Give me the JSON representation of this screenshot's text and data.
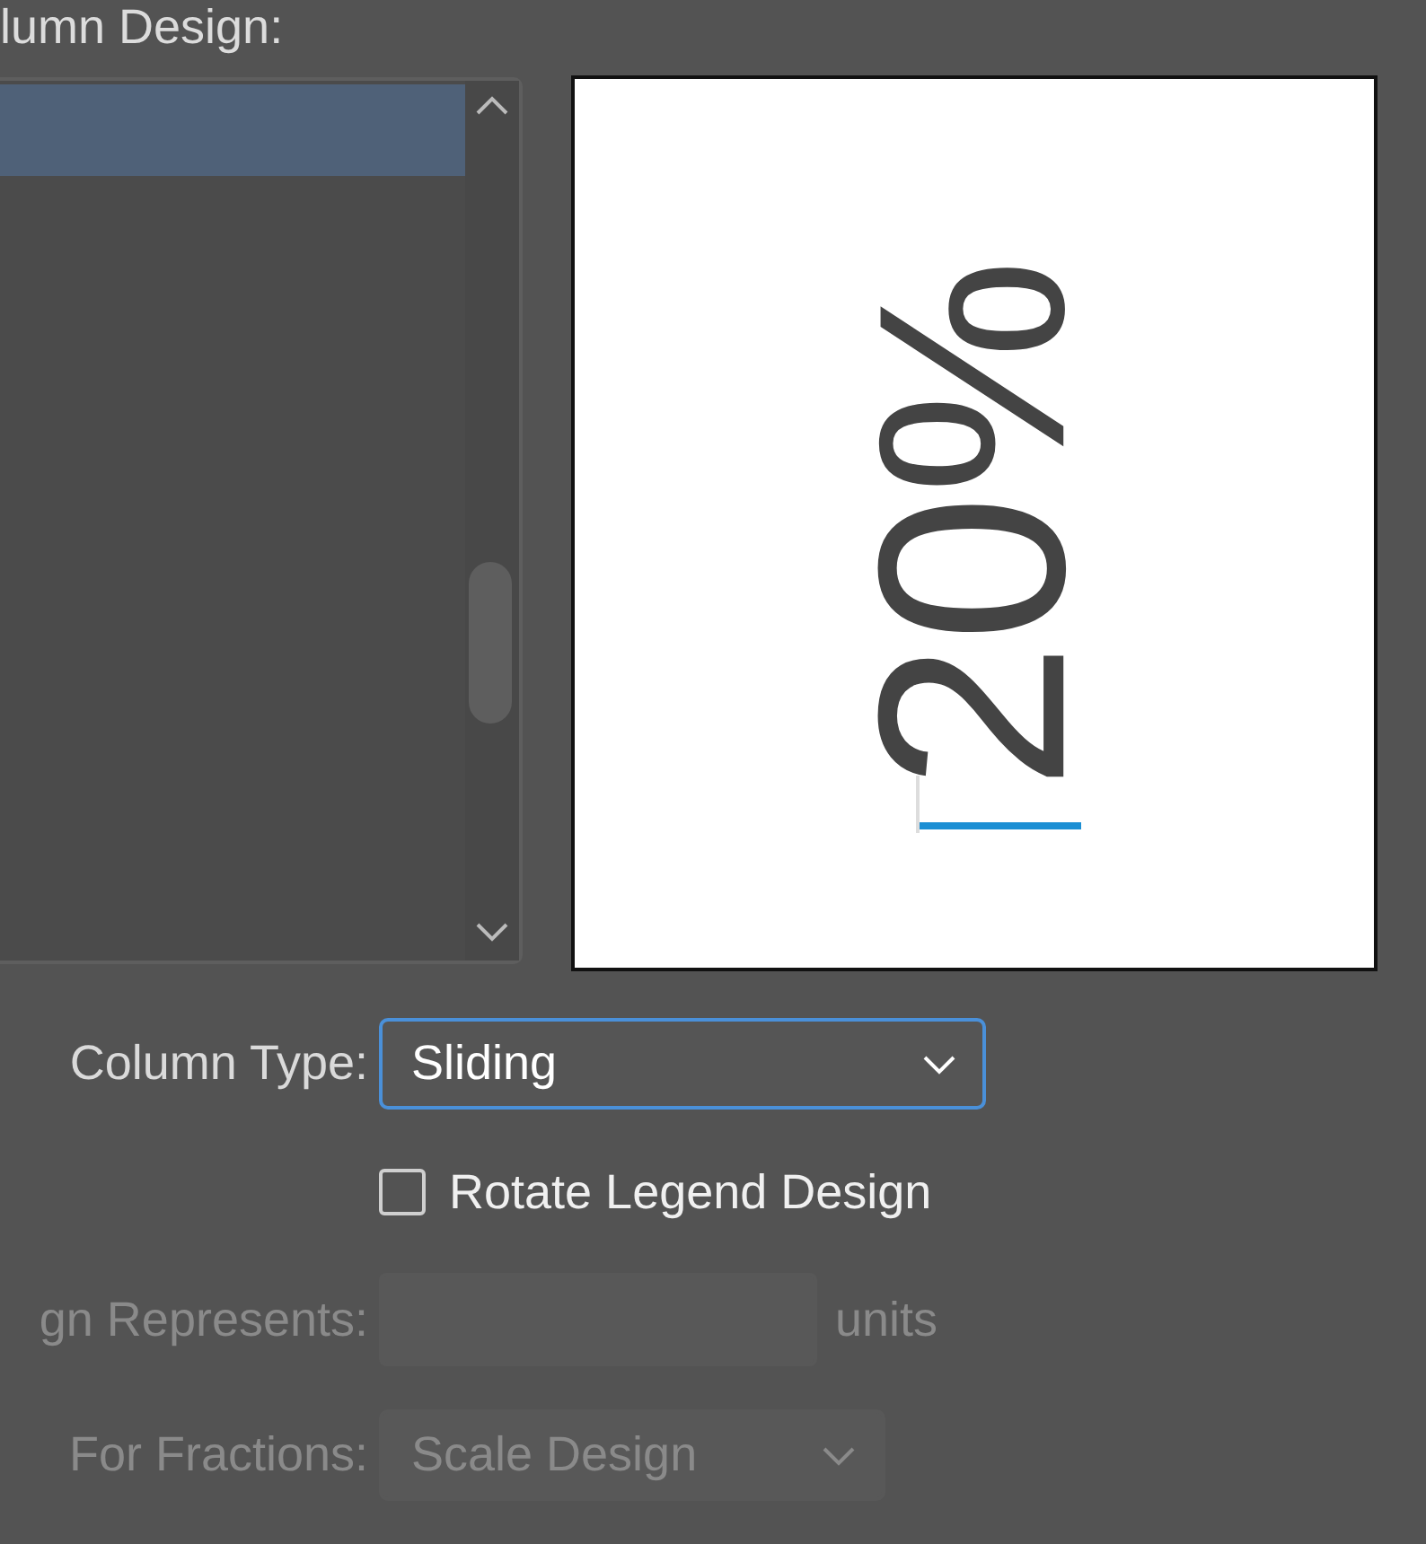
{
  "header": {
    "label": "lumn Design:"
  },
  "design_list": {
    "items": [
      {
        "selected": true
      }
    ]
  },
  "preview": {
    "text": "20%",
    "rotated": true
  },
  "column_type": {
    "label": "Column Type:",
    "value": "Sliding",
    "focused": true
  },
  "rotate_legend": {
    "label": "Rotate Legend Design",
    "checked": false
  },
  "each_design": {
    "label": "gn Represents:",
    "unit": "units",
    "disabled": true
  },
  "fractions": {
    "label": "For Fractions:",
    "value": "Scale Design",
    "disabled": true
  }
}
